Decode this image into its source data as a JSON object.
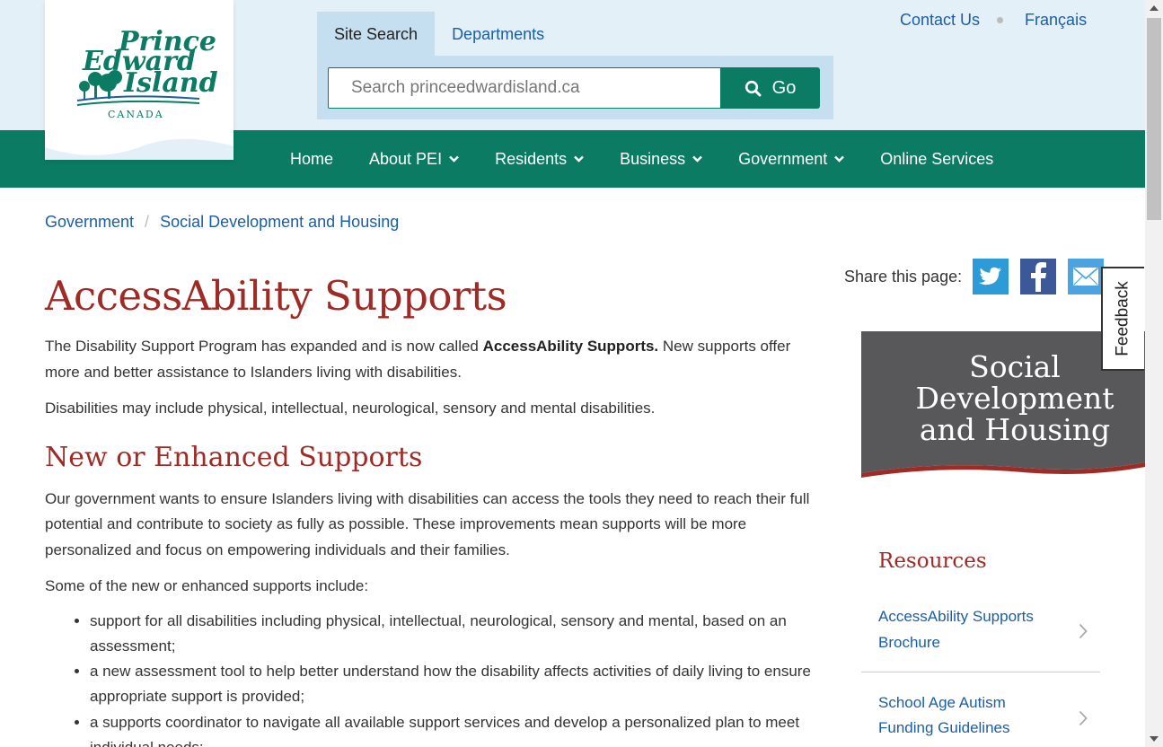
{
  "header": {
    "logo": {
      "line1": "Prince",
      "line2": "Edward",
      "line3": "Island",
      "country": "CANADA"
    },
    "search_tabs": [
      {
        "label": "Site Search",
        "active": true
      },
      {
        "label": "Departments",
        "active": false
      }
    ],
    "search": {
      "placeholder": "Search princeedwardisland.ca",
      "button_label": "Go"
    },
    "utility_links": {
      "contact": "Contact Us",
      "language": "Français"
    }
  },
  "nav": {
    "items": [
      {
        "label": "Home",
        "has_dropdown": false
      },
      {
        "label": "About PEI",
        "has_dropdown": true
      },
      {
        "label": "Residents",
        "has_dropdown": true
      },
      {
        "label": "Business",
        "has_dropdown": true
      },
      {
        "label": "Government",
        "has_dropdown": true
      },
      {
        "label": "Online Services",
        "has_dropdown": false
      }
    ]
  },
  "breadcrumb": [
    "Government",
    "Social Development and Housing"
  ],
  "share": {
    "label": "Share this page:",
    "icons": [
      "twitter-icon",
      "facebook-icon",
      "email-icon"
    ]
  },
  "feedback": {
    "label": "Feedback"
  },
  "main": {
    "title": "AccessAbility Supports",
    "intro_before": "The Disability Support Program has expanded and is now called ",
    "intro_bold": "AccessAbility Supports.",
    "intro_after": " New supports offer more and better assistance to Islanders living with disabilities.",
    "disabilities_text": "Disabilities may include physical, intellectual, neurological, sensory and mental disabilities.",
    "section_title": "New or Enhanced Supports",
    "section_text": "Our government wants to ensure Islanders living with disabilities can access the tools they need to reach their full potential and contribute to society as fully as possible.  These improvements mean supports will be more personalized and focus on empowering individuals and their families.",
    "list_intro": "Some of the new or enhanced supports include:",
    "list_items": [
      "support for all disabilities including physical, intellectual, neurological, sensory and mental, based on an assessment;",
      "a new assessment tool to help better understand how the disability affects activities of daily living to ensure appropriate support is provided;",
      "a supports coordinator to navigate all available support services and develop a personalized plan to meet individual needs;"
    ]
  },
  "sidebar": {
    "department": {
      "line1": "Social",
      "line2": "Development",
      "line3": "and Housing"
    },
    "resources_title": "Resources",
    "resources": [
      {
        "line1": "AccessAbility Supports",
        "line2": "Brochure"
      },
      {
        "line1": "School Age Autism",
        "line2": "Funding Guidelines"
      }
    ]
  },
  "colors": {
    "brand_green": "#0b7b63",
    "heading_red": "#9e2b25",
    "link_blue": "#1a5ea8",
    "header_bg": "#e4f0f8"
  }
}
